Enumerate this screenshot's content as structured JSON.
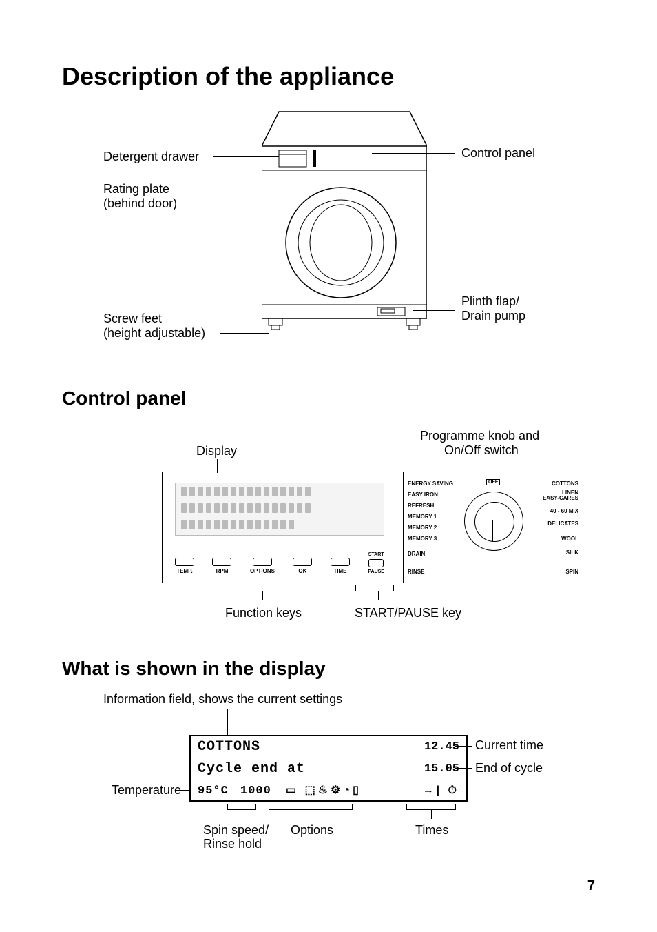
{
  "page_number": "7",
  "h1": "Description of the appliance",
  "appliance_labels": {
    "detergent_drawer": "Detergent drawer",
    "rating_plate_1": "Rating plate",
    "rating_plate_2": "(behind door)",
    "screw_feet_1": "Screw feet",
    "screw_feet_2": "(height adjustable)",
    "control_panel": "Control panel",
    "plinth_1": "Plinth flap/",
    "plinth_2": "Drain pump"
  },
  "h2_control": "Control panel",
  "control_labels": {
    "display": "Display",
    "knob_title_1": "Programme knob and",
    "knob_title_2": "On/Off switch",
    "function_keys": "Function keys",
    "start_pause": "START/PAUSE key"
  },
  "panel_buttons": {
    "temp": "TEMP.",
    "rpm": "RPM",
    "options": "OPTIONS",
    "ok": "OK",
    "time": "TIME",
    "start_l1": "START",
    "start_l2": "PAUSE"
  },
  "knob_labels": {
    "off": "OFF",
    "left": [
      "ENERGY SAVING",
      "EASY IRON",
      "REFRESH",
      "MEMORY 1",
      "MEMORY 2",
      "MEMORY 3",
      "DRAIN",
      "RINSE"
    ],
    "right": [
      "COTTONS",
      "LINEN\nEASY-CARES",
      "40 - 60 MIX",
      "DELICATES",
      "WOOL",
      "SILK",
      "SPIN"
    ]
  },
  "h2_display": "What is shown in the display",
  "display_labels": {
    "info_line": "Information field, shows the current settings",
    "current_time": "Current time",
    "end_of_cycle": "End of cycle",
    "temperature": "Temperature",
    "spin_1": "Spin speed/",
    "spin_2": "Rinse hold",
    "options": "Options",
    "times": "Times"
  },
  "lcd": {
    "line1_left": "COTTONS",
    "line1_right": "12.45",
    "line2_left": "Cycle end at",
    "line2_right": "15.05",
    "line3_temp": "95°C",
    "line3_spin": "1000",
    "line3_icons": "▭ ⬚♨⚙◔▯",
    "line3_right": "→| ⏱"
  }
}
